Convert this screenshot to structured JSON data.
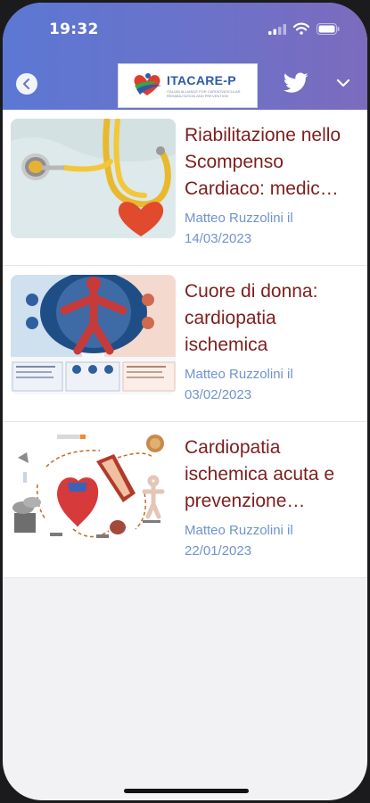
{
  "status_bar": {
    "time": "19:32"
  },
  "header": {
    "logo_text": "ITACARE-P",
    "logo_subtitle": "ITALIAN ALLIANCE FOR CARDIOVASCULAR REHABILITATION AND PREVENTION",
    "icons": [
      "back-icon",
      "twitter-icon",
      "chevron-down-icon"
    ]
  },
  "articles": [
    {
      "title": "Riabilitazione nello Scompenso Cardiaco: medic…",
      "meta": "Matteo Ruzzolini il 14/03/2023",
      "image": "stethoscope-heart"
    },
    {
      "title": "Cuore di donna: cardiopatia ischemica",
      "meta": "Matteo Ruzzolini il 03/02/2023",
      "image": "women-heart-infographic"
    },
    {
      "title": "Cardiopatia ischemica acuta e prevenzione…",
      "meta": "Matteo Ruzzolini il 22/01/2023",
      "image": "risk-factors-diagram"
    }
  ],
  "colors": {
    "header_gradient_start": "#5b78d3",
    "header_gradient_end": "#7c6bbd",
    "title": "#7d1e1e",
    "meta": "#6f93cf"
  }
}
